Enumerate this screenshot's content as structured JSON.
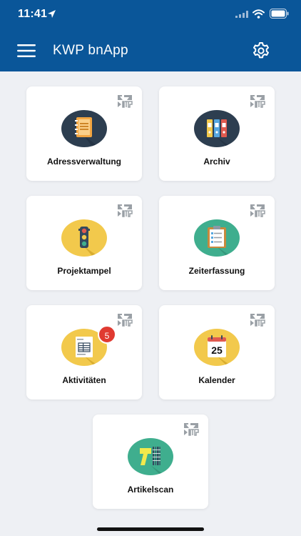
{
  "status_bar": {
    "time": "11:41"
  },
  "header": {
    "title": "KWP bnApp"
  },
  "tiles": [
    {
      "label": "Adressverwaltung",
      "icon": "address-book-icon",
      "circle_color": "#2d3e50"
    },
    {
      "label": "Archiv",
      "icon": "binders-icon",
      "circle_color": "#2d3e50"
    },
    {
      "label": "Projektampel",
      "icon": "traffic-light-icon",
      "circle_color": "#f2c94c"
    },
    {
      "label": "Zeiterfassung",
      "icon": "clipboard-icon",
      "circle_color": "#3fae8e"
    },
    {
      "label": "Aktivitäten",
      "icon": "document-icon",
      "circle_color": "#f2c94c",
      "badge": "5"
    },
    {
      "label": "Kalender",
      "icon": "calendar-icon",
      "circle_color": "#f2c94c",
      "day": "25"
    },
    {
      "label": "Artikelscan",
      "icon": "barcode-scan-icon",
      "circle_color": "#3fae8e"
    }
  ],
  "colors": {
    "header": "#0a5699",
    "background": "#eef0f4",
    "badge": "#e03a31"
  }
}
